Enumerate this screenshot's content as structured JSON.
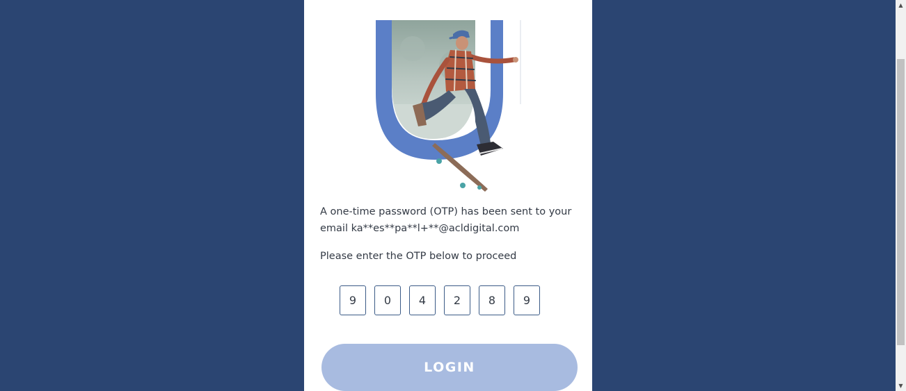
{
  "otp_notice": {
    "line1": "A one-time password (OTP) has been sent to your",
    "line2": "email ka**es**pa**l+**@acldigital.com"
  },
  "prompt": "Please enter the OTP below to proceed",
  "otp_digits": [
    "9",
    "0",
    "4",
    "2",
    "8",
    "9"
  ],
  "login_label": "LOGIN",
  "colors": {
    "page_background": "#2b4572",
    "brand_arch": "#5b7fc7",
    "login_button": "#a8bbe0",
    "otp_border": "#3a5a86"
  },
  "icons": {
    "scroll_up": "triangle-up",
    "scroll_down": "triangle-down"
  }
}
